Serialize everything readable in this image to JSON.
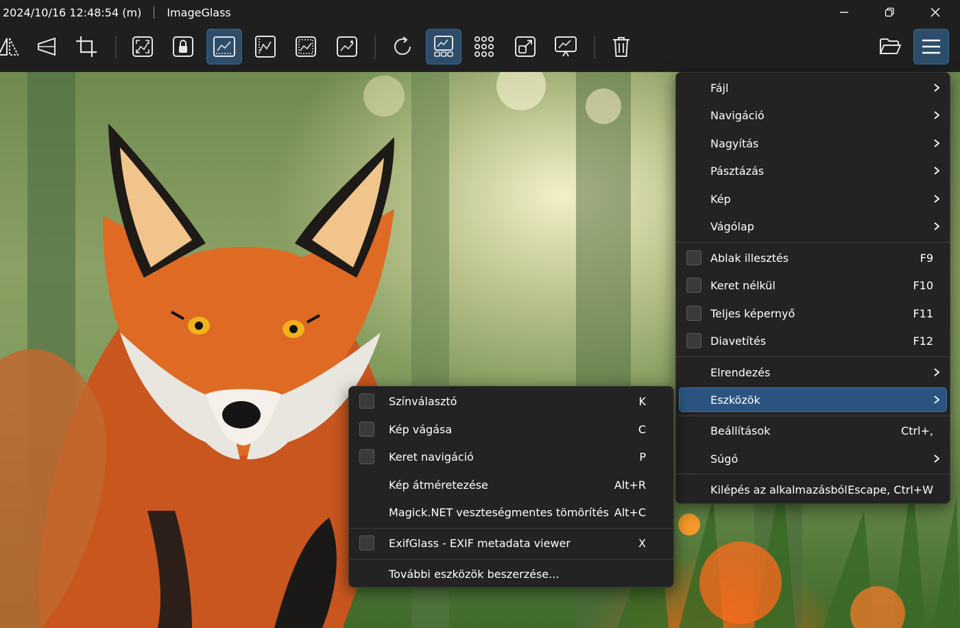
{
  "titlebar": {
    "filename": "2024/10/16 12:48:54 (m)",
    "app_name": "ImageGlass",
    "icons": [
      "minimize-icon",
      "restore-icon",
      "close-icon"
    ]
  },
  "toolbar": {
    "icons": [
      "flip-icon",
      "perspective-icon",
      "crop-icon",
      "auto-zoom-icon",
      "lock-zoom-icon",
      "scale-to-width-icon",
      "scale-to-height-icon",
      "scale-to-fit-icon",
      "scale-to-fill-icon",
      "refresh-icon",
      "gallery-icon",
      "thumbnail-grid-icon",
      "full-screen-icon",
      "slideshow-icon",
      "delete-icon",
      "open-folder-icon",
      "main-menu-icon"
    ],
    "active": [
      "scale-to-width-icon",
      "gallery-icon",
      "main-menu-icon"
    ],
    "accent_color": "#2d4d6b"
  },
  "main_menu": {
    "items": [
      {
        "label": "Fájl",
        "submenu": true
      },
      {
        "label": "Navigáció",
        "submenu": true
      },
      {
        "label": "Nagyítás",
        "submenu": true
      },
      {
        "label": "Pásztázás",
        "submenu": true
      },
      {
        "label": "Kép",
        "submenu": true
      },
      {
        "label": "Vágólap",
        "submenu": true
      },
      {
        "label": "Ablak illesztés",
        "shortcut": "F9",
        "checkbox": true,
        "checked": false
      },
      {
        "label": "Keret nélkül",
        "shortcut": "F10",
        "checkbox": true,
        "checked": false
      },
      {
        "label": "Teljes képernyő",
        "shortcut": "F11",
        "checkbox": true,
        "checked": false
      },
      {
        "label": "Diavetítés",
        "shortcut": "F12",
        "checkbox": true,
        "checked": false
      },
      {
        "label": "Elrendezés",
        "submenu": true
      },
      {
        "label": "Eszközök",
        "submenu": true,
        "highlighted": true
      },
      {
        "label": "Beállítások",
        "shortcut": "Ctrl+,"
      },
      {
        "label": "Súgó",
        "submenu": true
      },
      {
        "label": "Kilépés az alkalmazásból",
        "shortcut": "Escape, Ctrl+W"
      }
    ]
  },
  "tools_menu": {
    "items": [
      {
        "label": "Színválasztó",
        "shortcut": "K",
        "checkbox": true,
        "checked": false
      },
      {
        "label": "Kép vágása",
        "shortcut": "C",
        "checkbox": true,
        "checked": false
      },
      {
        "label": "Keret navigáció",
        "shortcut": "P",
        "checkbox": true,
        "checked": false
      },
      {
        "label": "Kép átméretezése",
        "shortcut": "Alt+R"
      },
      {
        "label": "Magick.NET veszteségmentes tömörítés",
        "shortcut": "Alt+C"
      },
      {
        "label": "ExifGlass - EXIF metadata viewer",
        "shortcut": "X",
        "checkbox": true,
        "checked": false
      },
      {
        "label": "További eszközök beszerzése..."
      }
    ]
  },
  "highlight_color": "#2b5580"
}
